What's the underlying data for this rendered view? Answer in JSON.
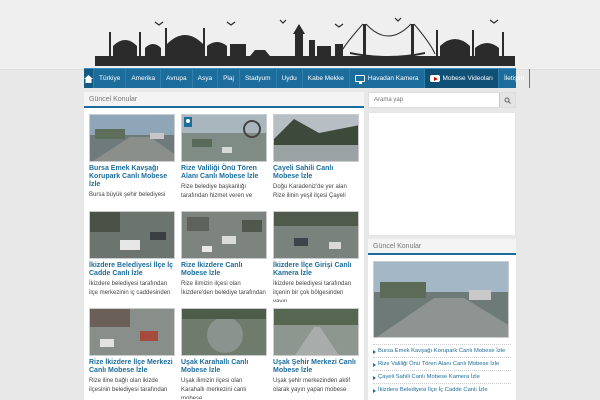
{
  "nav": {
    "items": [
      {
        "label": "Türkiye"
      },
      {
        "label": "Amerika"
      },
      {
        "label": "Avrupa"
      },
      {
        "label": "Asya"
      },
      {
        "label": "Plaj"
      },
      {
        "label": "Stadyum"
      },
      {
        "label": "Uydu"
      },
      {
        "label": "Kabe Mekke"
      },
      {
        "label": "Havadan Kamera",
        "icon": "tv-icon"
      },
      {
        "label": "Mobese Videoları",
        "icon": "youtube-icon"
      },
      {
        "label": "İletişim"
      }
    ]
  },
  "main": {
    "heading": "Güncel Konular",
    "cards": [
      {
        "title": "Bursa Emek Kavşağı Korupark Canlı Mobese İzle",
        "excerpt": "Bursa büyük şehir belediyesi"
      },
      {
        "title": "Rize Valiliği Önü Tören Alanı Canlı Mobese İzle",
        "excerpt": "Rize belediye başkanlığı tarafından hizmet veren ve"
      },
      {
        "title": "Çayeli Sahili Canlı Mobese İzle",
        "excerpt": "Doğu Karadeniz'de yer alan Rize ilinin yeşil ilçesi Çayeli"
      },
      {
        "title": "İkizdere Belediyesi İlçe İç Cadde Canlı İzle",
        "excerpt": "İkizdere belediyesi tarafından ilçe merkezinin iç caddesinden"
      },
      {
        "title": "Rize İkizdere Canlı Mobese İzle",
        "excerpt": "Rize ilimizin ilçesi olan İkizdere'den belediye tarafından"
      },
      {
        "title": "İkizdere İlçe Girişi Canlı Kamera İzle",
        "excerpt": "İkizdere belediyesi tarafından ilçenin bir çok bölgesinden yayın"
      },
      {
        "title": "Rize İkizdere İlçe Merkezi Canlı Mobese İzle",
        "excerpt": "Rize iline bağlı olan ikizde ilçesinin belediyesi tarafından"
      },
      {
        "title": "Uşak Karahallı Canlı Mobese İzle",
        "excerpt": "Uşak ilimizin ilçesi olan Karahallı merkezini canlı mobese"
      },
      {
        "title": "Uşak Şehir Merkezi Canlı Mobese İzle",
        "excerpt": "Uşak şehir merkezinden aktif olarak yayın yapan mobese"
      }
    ]
  },
  "sidebar": {
    "search_placeholder": "Arama yap",
    "heading": "Güncel Konular",
    "links": [
      "Bursa Emek Kavşağı Korupark Canlı Mobese İzle",
      "Rize Valiliği Önü Tören Alanı Canlı Mobese İzle",
      "Çayeli Sahili Canlı Mobese Kamera İzle",
      "İkizdere Belediyesi İlçe İç Cadde Canlı İzle"
    ]
  },
  "colors": {
    "accent": "#1c6d9c",
    "header_bg": "#efefef",
    "page_bg": "#e8e8e8"
  }
}
